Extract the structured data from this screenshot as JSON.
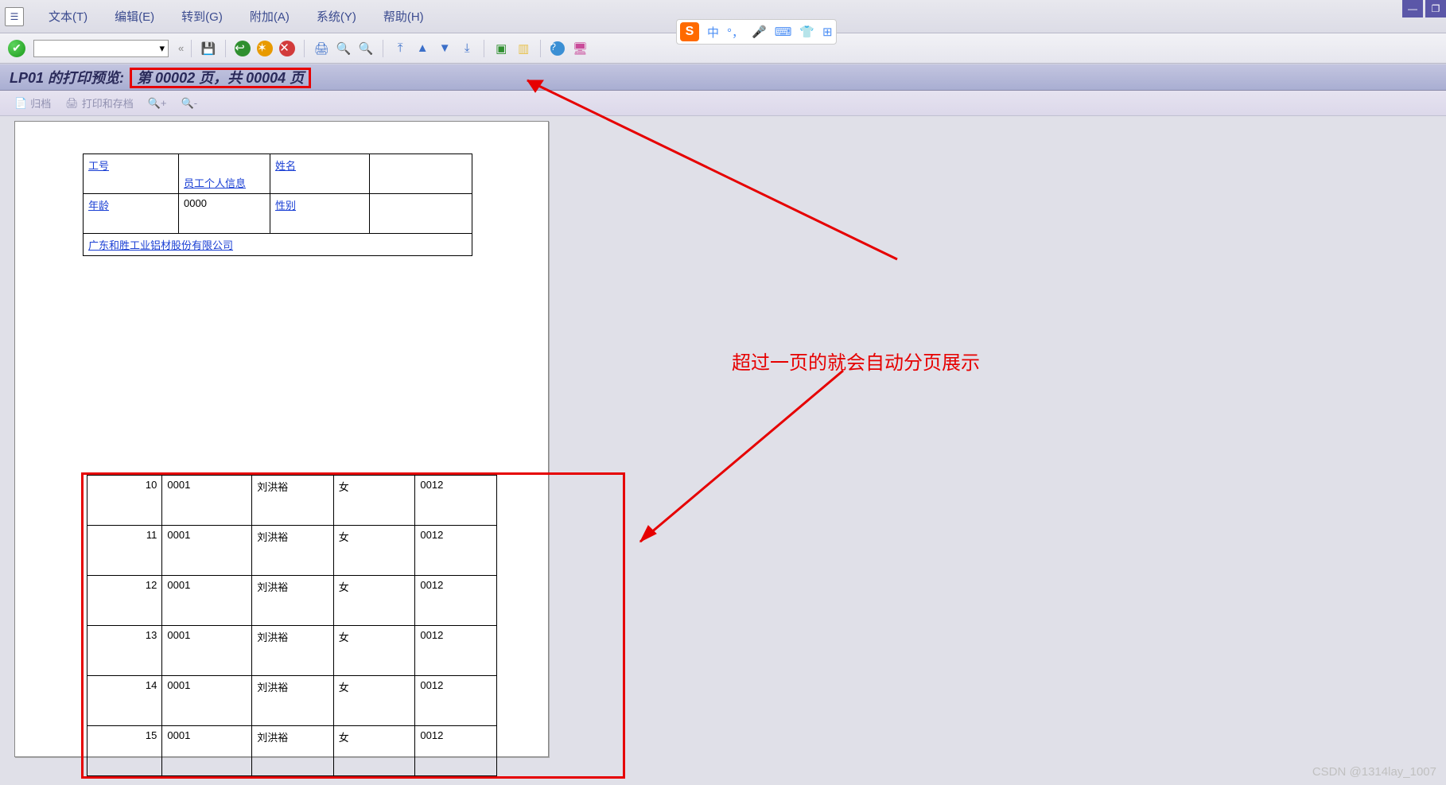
{
  "menu": {
    "items": [
      "文本(T)",
      "编辑(E)",
      "转到(G)",
      "附加(A)",
      "系统(Y)",
      "帮助(H)"
    ]
  },
  "ime": {
    "logo": "S",
    "lang": "中"
  },
  "title": {
    "prefix": "LP01",
    "mid": " 的打印预览: ",
    "page_text": "第 00002 页，共 00004  页"
  },
  "sub_toolbar": {
    "archive": "归档",
    "print_archive": "打印和存档"
  },
  "header": {
    "r1c1": "工号",
    "r1c2": "员工个人信息",
    "r1c3": "姓名",
    "r2c1": "年龄",
    "r2c2": "0000",
    "r2c3": "性别",
    "footer": "广东和胜工业铝材股份有限公司"
  },
  "rows": [
    {
      "idx": "10",
      "code": "0001",
      "name": "刘洪裕",
      "sex": "女",
      "num": "0012"
    },
    {
      "idx": "11",
      "code": "0001",
      "name": "刘洪裕",
      "sex": "女",
      "num": "0012"
    },
    {
      "idx": "12",
      "code": "0001",
      "name": "刘洪裕",
      "sex": "女",
      "num": "0012"
    },
    {
      "idx": "13",
      "code": "0001",
      "name": "刘洪裕",
      "sex": "女",
      "num": "0012"
    },
    {
      "idx": "14",
      "code": "0001",
      "name": "刘洪裕",
      "sex": "女",
      "num": "0012"
    },
    {
      "idx": "15",
      "code": "0001",
      "name": "刘洪裕",
      "sex": "女",
      "num": "0012"
    }
  ],
  "annotation": "超过一页的就会自动分页展示",
  "watermark": "CSDN @1314lay_1007"
}
